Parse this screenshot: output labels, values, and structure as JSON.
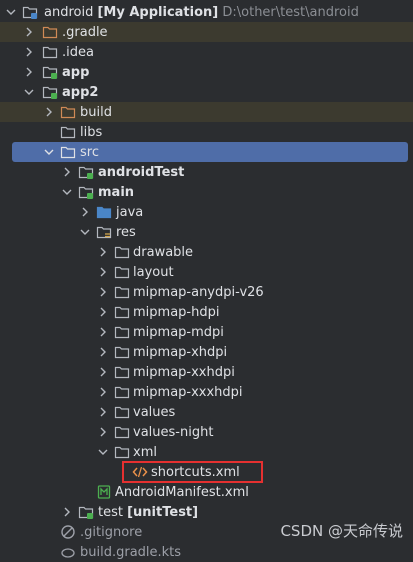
{
  "tree": {
    "root": {
      "name": "android",
      "module": "[My Application]",
      "path": "D:\\other\\test\\android"
    },
    "items": [
      {
        "label": ".gradle"
      },
      {
        "label": ".idea"
      },
      {
        "label": "app"
      },
      {
        "label": "app2"
      },
      {
        "label": "build"
      },
      {
        "label": "libs"
      },
      {
        "label": "src"
      },
      {
        "label": "androidTest"
      },
      {
        "label": "main"
      },
      {
        "label": "java"
      },
      {
        "label": "res"
      },
      {
        "label": "drawable"
      },
      {
        "label": "layout"
      },
      {
        "label": "mipmap-anydpi-v26"
      },
      {
        "label": "mipmap-hdpi"
      },
      {
        "label": "mipmap-mdpi"
      },
      {
        "label": "mipmap-xhdpi"
      },
      {
        "label": "mipmap-xxhdpi"
      },
      {
        "label": "mipmap-xxxhdpi"
      },
      {
        "label": "values"
      },
      {
        "label": "values-night"
      },
      {
        "label": "xml"
      },
      {
        "label": "shortcuts.xml"
      },
      {
        "label": "AndroidManifest.xml"
      },
      {
        "label": "test",
        "module": "[unitTest]"
      },
      {
        "label": ".gitignore"
      },
      {
        "label": "build.gradle.kts"
      }
    ]
  },
  "watermark": "CSDN @天命传说",
  "colors": {
    "background": "#2b2d30",
    "selection": "#4f6da8",
    "excluded_folder_bg": "#3c3a2f",
    "highlight_box": "#e53030",
    "java_folder": "#4a86c8",
    "module_badge": "#4caf50"
  }
}
